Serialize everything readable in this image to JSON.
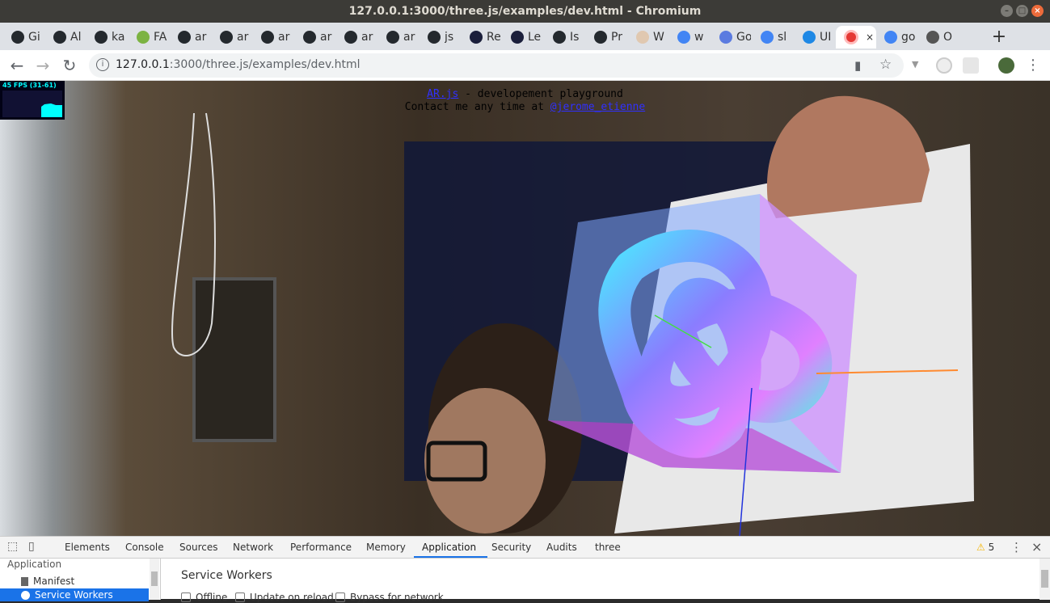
{
  "window": {
    "title": "127.0.0.1:3000/three.js/examples/dev.html - Chromium",
    "buttons": {
      "minimize": "–",
      "maximize": "□",
      "close": "×"
    }
  },
  "tabs": [
    {
      "label": "Gi",
      "icon": "github-icon"
    },
    {
      "label": "Al",
      "icon": "github-icon"
    },
    {
      "label": "ka",
      "icon": "github-icon"
    },
    {
      "label": "FA",
      "icon": "android-icon"
    },
    {
      "label": "ar",
      "icon": "github-icon"
    },
    {
      "label": "ar",
      "icon": "github-icon"
    },
    {
      "label": "ar",
      "icon": "github-icon"
    },
    {
      "label": "ar",
      "icon": "github-icon"
    },
    {
      "label": "ar",
      "icon": "github-icon"
    },
    {
      "label": "ar",
      "icon": "github-icon"
    },
    {
      "label": "js",
      "icon": "github-icon"
    },
    {
      "label": "Re",
      "icon": "react-icon"
    },
    {
      "label": "Le",
      "icon": "react-icon"
    },
    {
      "label": "Is",
      "icon": "github-icon"
    },
    {
      "label": "Pr",
      "icon": "github-icon"
    },
    {
      "label": "W",
      "icon": "hand-icon"
    },
    {
      "label": "w",
      "icon": "google-icon"
    },
    {
      "label": "Go",
      "icon": "translate-icon"
    },
    {
      "label": "sl",
      "icon": "google-icon"
    },
    {
      "label": "UI",
      "icon": "extension-icon"
    },
    {
      "label": "",
      "icon": "recording-icon",
      "active": true,
      "close": "×"
    },
    {
      "label": "go",
      "icon": "google-icon"
    },
    {
      "label": "O",
      "icon": "ship-icon"
    }
  ],
  "newtab": "+",
  "toolbar": {
    "back": "←",
    "forward": "→",
    "reload": "↻",
    "url_host": "127.0.0.1",
    "url_path": ":3000/three.js/examples/dev.html",
    "camera": "▮",
    "star": "☆",
    "menu": "⋮"
  },
  "page": {
    "fps_label": "45 FPS (31-61)",
    "overlay_link": "AR.js",
    "overlay_line1_rest": " - developement playground",
    "overlay_line2_prefix": "Contact me any time at ",
    "overlay_contact": "@jerome_etienne"
  },
  "devtools": {
    "tabs": [
      "Elements",
      "Console",
      "Sources",
      "Network",
      "Performance",
      "Memory",
      "Application",
      "Security",
      "Audits",
      "three"
    ],
    "active_tab": "Application",
    "warnings": "5",
    "warning_icon": "⚠",
    "menu": "⋮",
    "close": "×",
    "sidebar": {
      "heading": "Application",
      "items": [
        {
          "label": "Manifest",
          "icon": "file-icon"
        },
        {
          "label": "Service Workers",
          "icon": "gear-icon",
          "selected": true
        }
      ]
    },
    "main": {
      "heading": "Service Workers",
      "checkboxes": [
        {
          "label": "Offline",
          "checked": false
        },
        {
          "label": "Update on reload",
          "checked": false
        },
        {
          "label": "Bypass for network",
          "checked": false
        }
      ]
    }
  },
  "colors": {
    "title_bar": "#3c3b37",
    "tab_strip": "#dee1e6",
    "accent": "#1a73e8",
    "fps_text": "#00ffff"
  }
}
